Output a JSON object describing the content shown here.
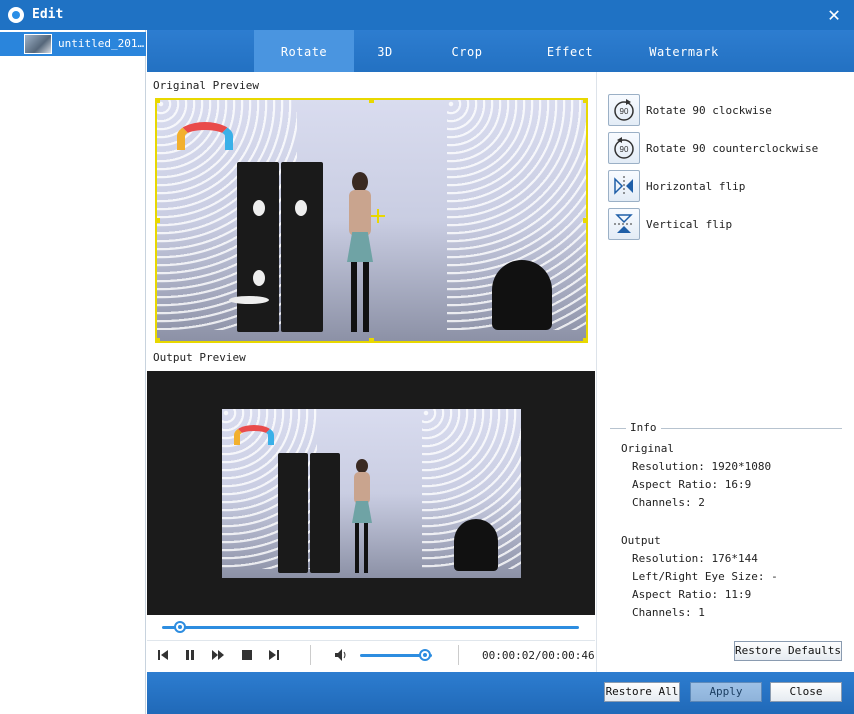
{
  "window": {
    "title": "Edit"
  },
  "sidebar": {
    "items": [
      {
        "label": "untitled_201…"
      }
    ]
  },
  "tabs": [
    {
      "label": "Rotate",
      "active": true
    },
    {
      "label": "3D"
    },
    {
      "label": "Crop"
    },
    {
      "label": "Effect"
    },
    {
      "label": "Watermark"
    }
  ],
  "preview": {
    "original_label": "Original Preview",
    "output_label": "Output Preview"
  },
  "playback": {
    "progress": 0.043,
    "volume": 0.9,
    "timecode": "00:00:02/00:00:46"
  },
  "rotate_actions": [
    {
      "label": "Rotate 90 clockwise",
      "icon": "rotate-clockwise-icon"
    },
    {
      "label": "Rotate 90 counterclockwise",
      "icon": "rotate-counterclockwise-icon"
    },
    {
      "label": "Horizontal flip",
      "icon": "horizontal-flip-icon"
    },
    {
      "label": "Vertical flip",
      "icon": "vertical-flip-icon"
    }
  ],
  "info": {
    "legend": "Info",
    "original_heading": "Original",
    "original_resolution": "Resolution: 1920*1080",
    "original_aspect": "Aspect Ratio: 16:9",
    "original_channels": "Channels: 2",
    "output_heading": "Output",
    "output_resolution": "Resolution: 176*144",
    "output_eye_size": "Left/Right Eye Size: -",
    "output_aspect": "Aspect Ratio: 11:9",
    "output_channels": "Channels: 1"
  },
  "buttons": {
    "restore_defaults": "Restore Defaults",
    "restore_all": "Restore All",
    "apply": "Apply",
    "close": "Close"
  },
  "colors": {
    "accent": "#2371c2",
    "crop_frame": "#e8d800"
  }
}
